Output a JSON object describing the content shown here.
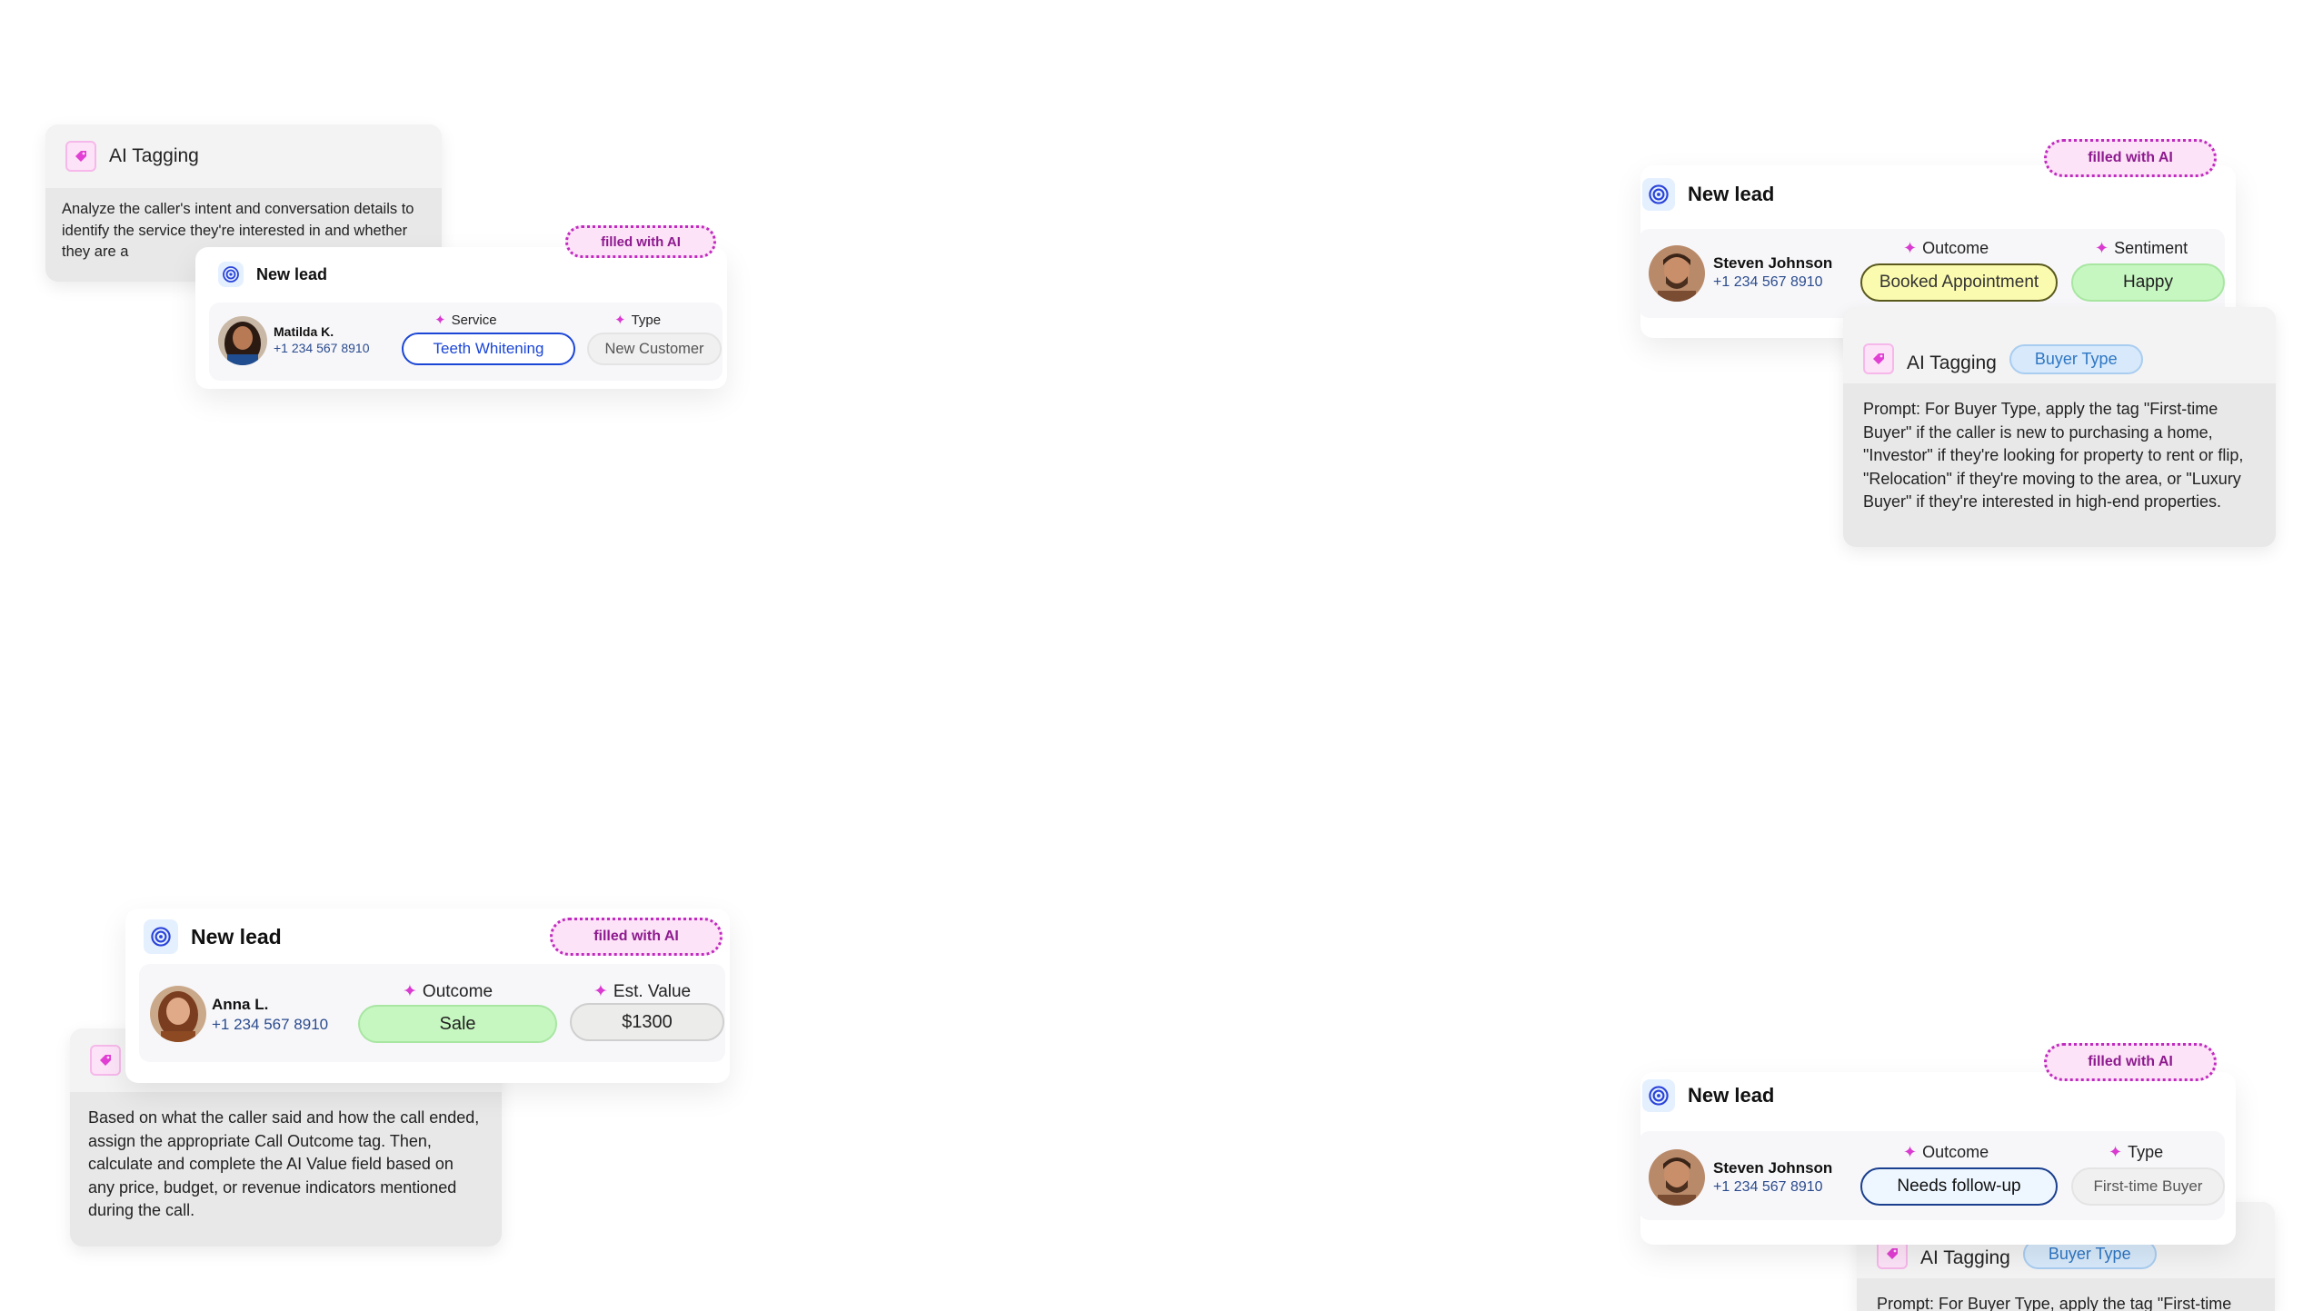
{
  "colors": {
    "accent_pink": "#d93ad0",
    "badge_border": "#c02bbf",
    "blue_pill": "#1b46d6",
    "green_pill": "#c7f7c1",
    "yellow_pill": "#fbfbb0"
  },
  "icons": {
    "tag": "tag-icon",
    "target": "target-icon",
    "sparkle": "sparkle-icon"
  },
  "panel_top_left": {
    "title": "AI Tagging",
    "body": "Analyze the caller's intent and conversation details to identify the service they're interested in and whether they are a"
  },
  "card_top_left": {
    "badge": "filled with AI",
    "title": "New lead",
    "name": "Matilda K.",
    "phone": "+1 234 567 8910",
    "field1_label": "Service",
    "field1_value": "Teeth Whitening",
    "field2_label": "Type",
    "field2_value": "New Customer"
  },
  "card_top_right": {
    "badge": "filled with AI",
    "title": "New lead",
    "name": "Steven Johnson",
    "phone": "+1 234 567 8910",
    "field1_label": "Outcome",
    "field1_value": "Booked Appointment",
    "field2_label": "Sentiment",
    "field2_value": "Happy"
  },
  "panel_top_right": {
    "title": "AI Tagging",
    "badge": "Buyer Type",
    "body": "Prompt: For Buyer Type, apply the tag \"First-time Buyer\" if the caller is new to purchasing a home, \"Investor\" if they're looking for property to rent or flip, \"Relocation\" if they're moving to the area, or \"Luxury Buyer\" if they're interested in high-end properties."
  },
  "card_bottom_left": {
    "badge": "filled with AI",
    "title": "New lead",
    "name": "Anna L.",
    "phone": "+1 234 567 8910",
    "field1_label": "Outcome",
    "field1_value": "Sale",
    "field2_label": "Est. Value",
    "field2_value": "$1300"
  },
  "panel_bottom_left": {
    "body": "Based on what the caller said and how the call ended, assign the appropriate Call Outcome tag. Then, calculate and complete the AI Value field based on any price, budget, or revenue indicators mentioned during the call."
  },
  "card_bottom_right": {
    "badge": "filled with AI",
    "title": "New lead",
    "name": "Steven Johnson",
    "phone": "+1 234 567 8910",
    "field1_label": "Outcome",
    "field1_value": "Needs follow-up",
    "field2_label": "Type",
    "field2_value": "First-time Buyer"
  },
  "panel_bottom_right": {
    "title": "AI Tagging",
    "badge": "Buyer Type",
    "body": "Prompt: For Buyer Type, apply the tag \"First-time"
  }
}
